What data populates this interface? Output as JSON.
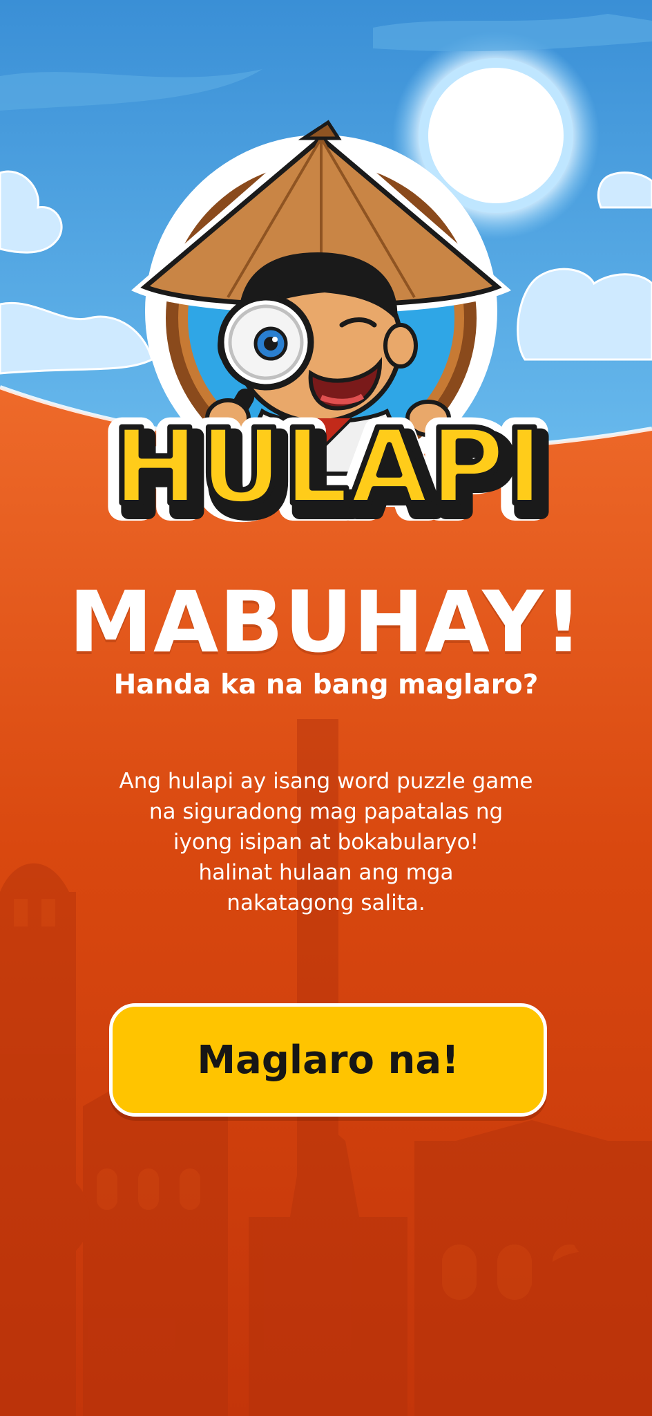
{
  "logo": {
    "text": "HULAPI"
  },
  "welcome": {
    "title": "MABUHAY!",
    "subtitle": "Handa ka na bang maglaro?"
  },
  "description": {
    "lines": [
      "Ang hulapi ay isang word puzzle game",
      "na siguradong mag papatalas ng",
      "iyong isipan at bokabularyo!",
      "halinat hulaan ang mga",
      "nakatagong salita."
    ]
  },
  "play_button": {
    "label": "Maglaro na!"
  },
  "colors": {
    "sky_top": "#3a8fd6",
    "sky_bottom": "#6bbcee",
    "ground_top": "#ee6a2a",
    "ground_bottom": "#c3350a",
    "button": "#ffc400",
    "logo_text": "#ffcc1a",
    "text": "#ffffff"
  }
}
